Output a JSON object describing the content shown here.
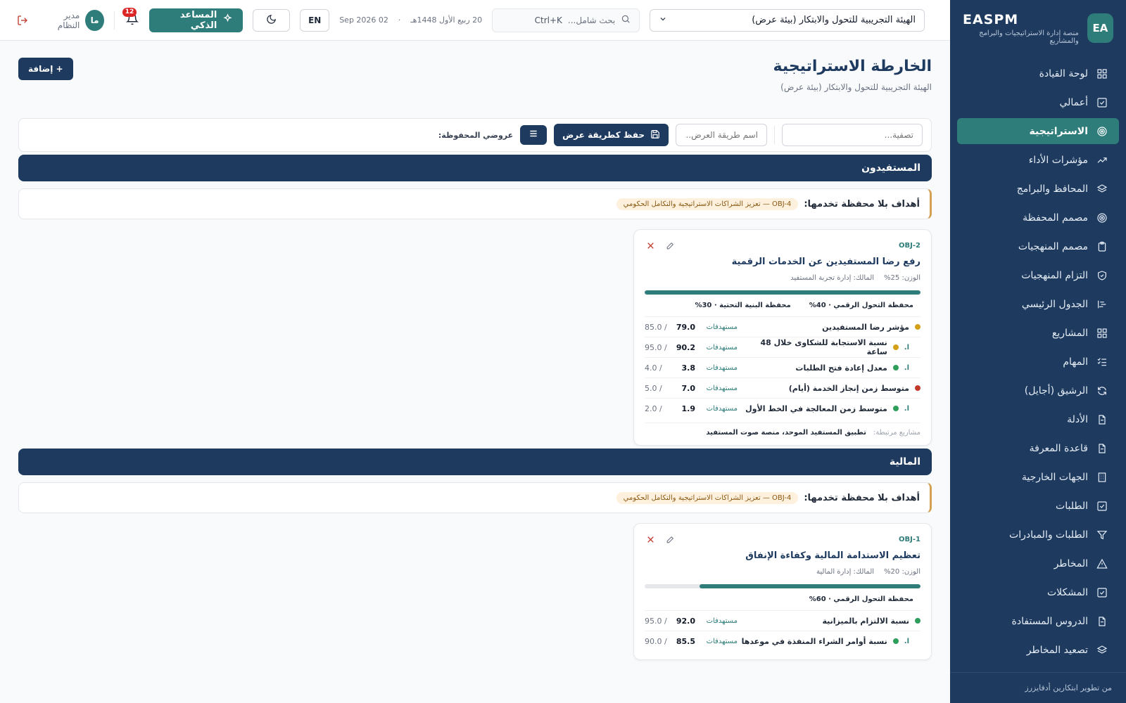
{
  "sidebar": {
    "logo": "EA",
    "brand": "EASPM",
    "subtitle": "منصة إدارة الاستراتيجيات والبرامج والمشاريع",
    "items": [
      {
        "label": "لوحة القيادة",
        "icon": "grid-icon"
      },
      {
        "label": "أعمالي",
        "icon": "check-square-icon"
      },
      {
        "label": "الاستراتيجية",
        "icon": "target-icon",
        "active": true
      },
      {
        "label": "مؤشرات الأداء",
        "icon": "trend-icon"
      },
      {
        "label": "المحافظ والبرامج",
        "icon": "layers-icon"
      },
      {
        "label": "مصمم المحفظة",
        "icon": "target-icon"
      },
      {
        "label": "مصمم المنهجيات",
        "icon": "clipboard-icon"
      },
      {
        "label": "التزام المنهجيات",
        "icon": "shield-icon"
      },
      {
        "label": "الجدول الرئيسي",
        "icon": "gantt-icon"
      },
      {
        "label": "المشاريع",
        "icon": "grid-icon"
      },
      {
        "label": "المهام",
        "icon": "tasks-icon"
      },
      {
        "label": "الرشيق (أجايل)",
        "icon": "refresh-icon"
      },
      {
        "label": "الأدلة",
        "icon": "file-icon"
      },
      {
        "label": "قاعدة المعرفة",
        "icon": "file-icon"
      },
      {
        "label": "الجهات الخارجية",
        "icon": "building-icon"
      },
      {
        "label": "الطلبات",
        "icon": "check-square-icon"
      },
      {
        "label": "الطلبات والمبادرات",
        "icon": "filter-icon"
      },
      {
        "label": "المخاطر",
        "icon": "alert-icon"
      },
      {
        "label": "المشكلات",
        "icon": "check-square-icon"
      },
      {
        "label": "الدروس المستفادة",
        "icon": "file-icon"
      },
      {
        "label": "تصعيد المخاطر",
        "icon": "layers-icon"
      }
    ],
    "footer": "من تطوير ابتكارين أدفايزرز"
  },
  "topbar": {
    "org": "الهيئة التجريبية للتحول والابتكار (بيئة عرض)",
    "search_placeholder": "بحث شامل...",
    "search_shortcut": "Ctrl+K",
    "hijri_date": "20 ربيع الأول 1448هـ",
    "gregorian_date": "02 Sep 2026",
    "lang": "EN",
    "assistant": "المساعد الذكي",
    "notifications": "12",
    "avatar": "ما",
    "user": "مدير النظام"
  },
  "page": {
    "title": "الخارطة الاستراتيجية",
    "subtitle": "الهيئة التجريبية للتحول والابتكار (بيئة عرض)",
    "add": "+ إضافة",
    "filter_placeholder": "تصفية...",
    "view_name_placeholder": "اسم طريقة العرض...",
    "save_view": "حفظ كطريقة عرض",
    "saved_views": "عروضي المحفوظة:"
  },
  "sections": [
    {
      "title": "المستفيدون",
      "unassigned_label": "أهداف بلا محفظة تخدمها:",
      "unassigned_chip": "OBJ-4 — تعزيز الشراكات الاستراتيجية والتكامل الحكومي",
      "card": {
        "code": "OBJ-2",
        "title": "رفع رضا المستفيدين عن الخدمات الرقمية",
        "weight": "الوزن: 25%",
        "owner": "المالك: إدارة تجربة المستفيد",
        "progress": 1.0,
        "portfolios": [
          "محفظة التحول الرقمي · 40%",
          "محفظة البنية التحتية · 30%"
        ],
        "kpis": [
          {
            "name": "مؤشر رضا المستفيدين",
            "sub": false,
            "status": "#d4a017",
            "tag": "مستهدفات",
            "value": "79.0",
            "target": "85.0 /"
          },
          {
            "name": "نسبة الاستجابة للشكاوى خلال 48 ساعة",
            "sub": true,
            "status": "#d4a017",
            "tag": "مستهدفات",
            "value": "90.2",
            "target": "95.0 /"
          },
          {
            "name": "معدل إعادة فتح الطلبات",
            "sub": true,
            "status": "#2e9e5b",
            "tag": "مستهدفات",
            "value": "3.8",
            "target": "4.0 /"
          },
          {
            "name": "متوسط زمن إنجاز الخدمة (أيام)",
            "sub": false,
            "status": "#c0392b",
            "tag": "مستهدفات",
            "value": "7.0",
            "target": "5.0 /"
          },
          {
            "name": "متوسط زمن المعالجة في الخط الأول",
            "sub": true,
            "status": "#2e9e5b",
            "tag": "مستهدفات",
            "value": "1.9",
            "target": "2.0 /"
          }
        ],
        "linked_label": "مشاريع مرتبطة:",
        "linked_value": "تطبيق المستفيد الموحد، منصة صوت المستفيد"
      }
    },
    {
      "title": "المالية",
      "unassigned_label": "أهداف بلا محفظة تخدمها:",
      "unassigned_chip": "OBJ-4 — تعزيز الشراكات الاستراتيجية والتكامل الحكومي",
      "card": {
        "code": "OBJ-1",
        "title": "تعظيم الاستدامة المالية وكفاءة الإنفاق",
        "weight": "الوزن: 20%",
        "owner": "المالك: إدارة المالية",
        "progress": 0.8,
        "portfolios": [
          "محفظة التحول الرقمي · 60%"
        ],
        "kpis": [
          {
            "name": "نسبة الالتزام بالميزانية",
            "sub": false,
            "status": "#2e9e5b",
            "tag": "مستهدفات",
            "value": "92.0",
            "target": "95.0 /"
          },
          {
            "name": "نسبة أوامر الشراء المنفذة في موعدها",
            "sub": true,
            "status": "#2e9e5b",
            "tag": "مستهدفات",
            "value": "85.5",
            "target": "90.0 /"
          }
        ]
      }
    }
  ]
}
